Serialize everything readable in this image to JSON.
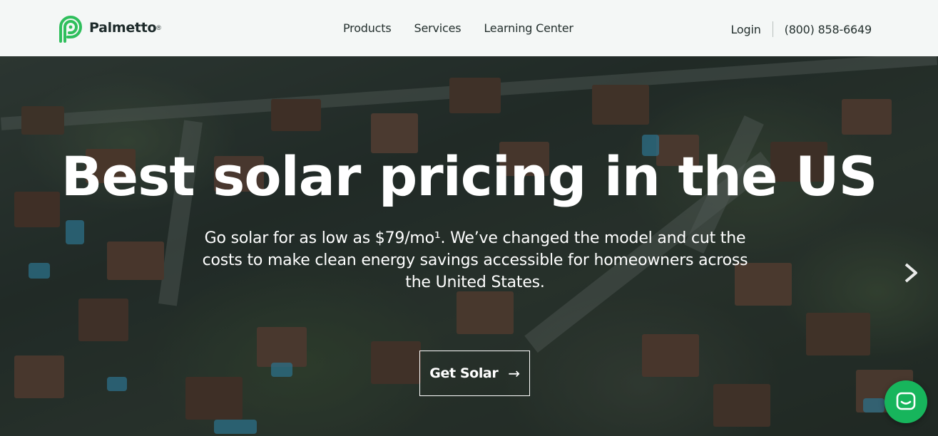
{
  "brand": {
    "name": "Palmetto",
    "trademark": "®",
    "logo_icon": "palmetto-logo-icon",
    "accent_color": "#2fbf5c"
  },
  "nav": {
    "items": [
      {
        "label": "Products"
      },
      {
        "label": "Services"
      },
      {
        "label": "Learning Center"
      }
    ],
    "login_label": "Login",
    "phone": "(800) 858-6649"
  },
  "hero": {
    "headline": "Best solar pricing in the US",
    "subtext": "Go solar for as low as $79/mo¹. We’ve changed the model and cut the costs to make clean energy savings accessible for homeowners across the United States.",
    "cta_label": "Get Solar",
    "cta_icon": "arrow-right-icon",
    "next_icon": "chevron-right-icon",
    "background": "aerial photo of suburban neighborhood"
  },
  "chat": {
    "icon": "chat-icon",
    "color": "#17b55c"
  }
}
